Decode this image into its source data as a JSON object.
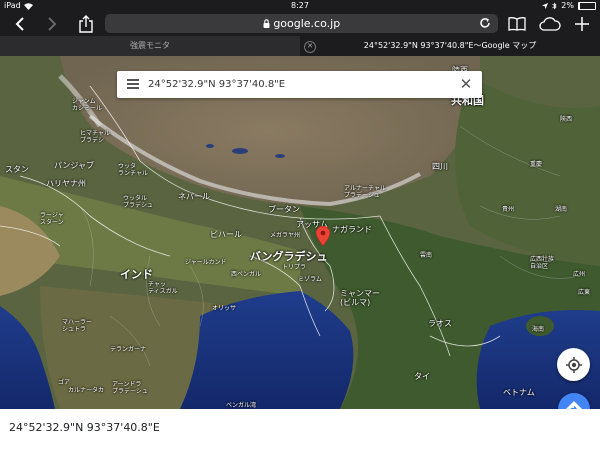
{
  "status_bar": {
    "device": "iPad",
    "time": "8:27",
    "battery": "2%"
  },
  "toolbar": {
    "url": "google.co.jp"
  },
  "tabs": [
    {
      "label": "強震モニタ"
    },
    {
      "label": "24°52'32.9\"N 93°37'40.8\"E～Google マップ"
    }
  ],
  "search": {
    "value": "24°52'32.9\"N 93°37'40.8\"E"
  },
  "map_labels": {
    "kyowakoku": "共和国",
    "ritou": "陸西",
    "jammu": "ジャンム\nカシミール",
    "himachal": "ヒマチャル\nプラデシ",
    "panjab": "パンジャブ",
    "uttaranchal": "ウッタ\nランチャル",
    "haryana": "ハリヤナ州",
    "stan": "スタン",
    "uttar": "ウッタル\nプラデシュ",
    "nepal": "ネパール",
    "rajasthan": "ラージャ\nスターン",
    "arunachal": "アルナーチャル\nプラデーシュ",
    "bhutan": "ブータン",
    "assam": "アッサム",
    "nagaland": "ナガランド",
    "meghalaya": "メガラヤ州",
    "bihar": "ビハール",
    "shisen": "四川",
    "jharkhand": "ジャールカンド",
    "bangladesh": "バングラデシュ",
    "india": "インド",
    "westbengal": "西ベンガル",
    "tripura": "トリプラ",
    "chhattisgarh": "チャッ\nティスガル",
    "mizoram": "ミゾラム",
    "odisha": "オリッサ",
    "myanmar": "ミャンマー\n(ビルマ)",
    "maharashtra": "マハーラー\nシュトラ",
    "telangana": "テランガーナ",
    "goa": "ゴア",
    "karnataka": "カルナータカ",
    "andhra": "アーンドラ\nプラデーシュ",
    "bengalwan": "ベンガル湾",
    "laos": "ラオス",
    "thai": "タイ",
    "vietnam": "ベトナム",
    "hainan": "海南",
    "unnan": "雲南",
    "guizhou": "貴州",
    "hunan": "湖南",
    "guangxi": "広西壮族\n自治区",
    "koushuu": "広州",
    "kanton": "広東",
    "china_nw": "陝西",
    "chongqing": "重慶"
  },
  "pin": {
    "color": "#ea4335"
  },
  "buttons": {
    "location_icon": "my-location-icon",
    "directions_icon": "directions-icon"
  },
  "bottom": {
    "coords": "24°52'32.9\"N 93°37'40.8\"E"
  },
  "colors": {
    "accent": "#4285f4",
    "pin": "#ea4335"
  }
}
